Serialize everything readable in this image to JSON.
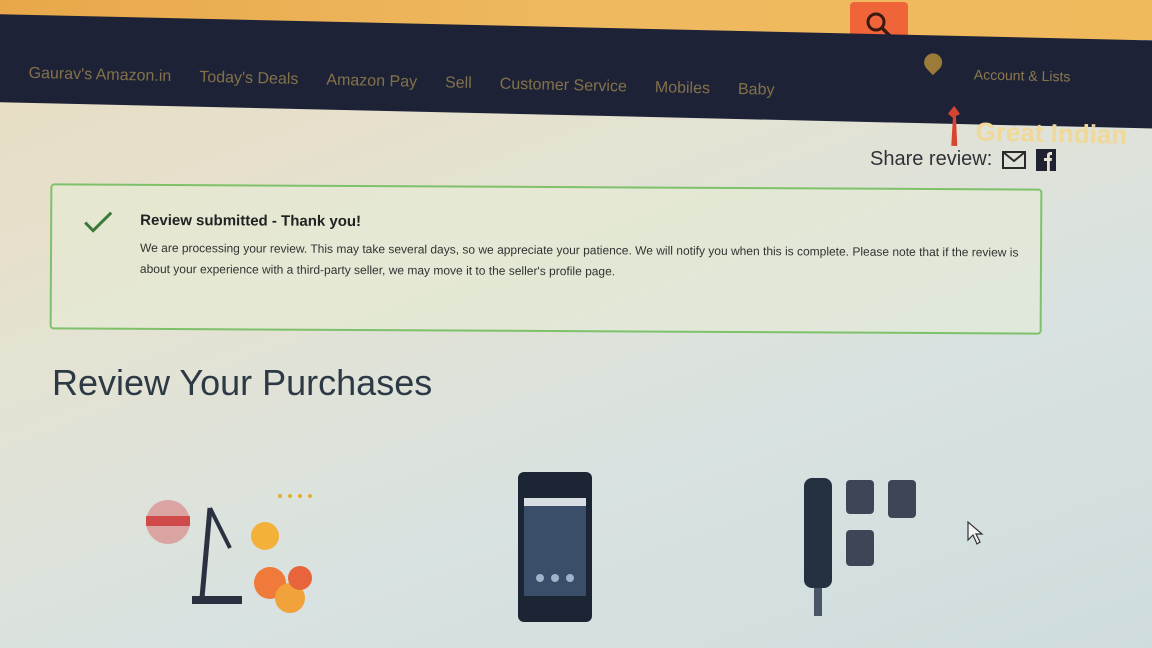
{
  "header": {
    "search_button_icon": "search-icon",
    "nav_links": [
      "Gaurav's Amazon.in",
      "Today's Deals",
      "Amazon Pay",
      "Sell",
      "Customer Service",
      "Mobiles",
      "Baby"
    ],
    "account_label": "Account & Lists",
    "location_icon": "location-pin-icon",
    "promo_text": "Great Indian"
  },
  "share": {
    "label": "Share review:",
    "icons": [
      "mail-icon",
      "facebook-icon"
    ]
  },
  "alert": {
    "icon": "checkmark-icon",
    "title": "Review submitted - Thank you!",
    "body": "We are processing your review. This may take several days, so we appreciate your patience. We will notify you when this is complete. Please note that if the review is about your experience with a third-party seller, we may move it to the seller's profile page."
  },
  "main": {
    "heading": "Review Your Purchases",
    "products": [
      {
        "image": "citrus-juicer-image"
      },
      {
        "image": "smartphone-image"
      },
      {
        "image": "hand-blender-image"
      }
    ]
  },
  "colors": {
    "nav_bg": "#1d2237",
    "search_bg": "#f0643a",
    "alert_border": "#7ec16a",
    "check": "#3c7a3c"
  }
}
